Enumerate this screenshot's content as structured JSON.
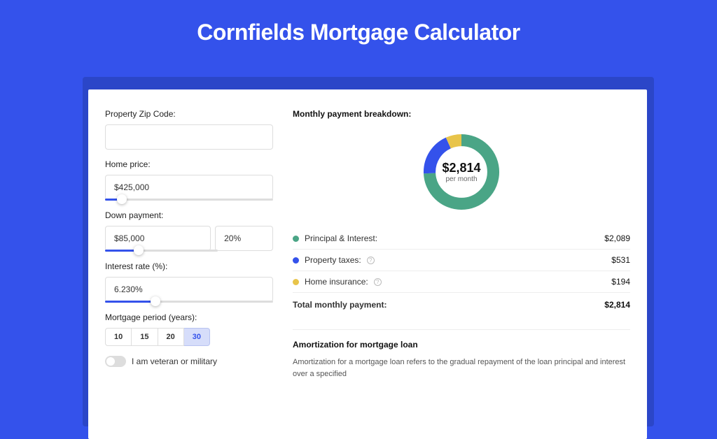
{
  "title": "Cornfields Mortgage Calculator",
  "form": {
    "zip_label": "Property Zip Code:",
    "zip_value": "",
    "home_price_label": "Home price:",
    "home_price_value": "$425,000",
    "down_payment_label": "Down payment:",
    "down_payment_value": "$85,000",
    "down_payment_pct": "20%",
    "interest_label": "Interest rate (%):",
    "interest_value": "6.230%",
    "period_label": "Mortgage period (years):",
    "periods": [
      "10",
      "15",
      "20",
      "30"
    ],
    "period_active": "30",
    "veteran_label": "I am veteran or military"
  },
  "breakdown": {
    "title": "Monthly payment breakdown:",
    "total_amount": "$2,814",
    "per_month": "per month",
    "rows": [
      {
        "label": "Principal & Interest:",
        "value": "$2,089",
        "color": "#4aa586",
        "info": false
      },
      {
        "label": "Property taxes:",
        "value": "$531",
        "color": "#3452eb",
        "info": true
      },
      {
        "label": "Home insurance:",
        "value": "$194",
        "color": "#e8c44a",
        "info": true
      }
    ],
    "total_label": "Total monthly payment:",
    "total_value": "$2,814"
  },
  "amort": {
    "title": "Amortization for mortgage loan",
    "text": "Amortization for a mortgage loan refers to the gradual repayment of the loan principal and interest over a specified"
  },
  "chart_data": {
    "type": "pie",
    "series": [
      {
        "name": "Principal & Interest",
        "value": 2089,
        "color": "#4aa586"
      },
      {
        "name": "Property taxes",
        "value": 531,
        "color": "#3452eb"
      },
      {
        "name": "Home insurance",
        "value": 194,
        "color": "#e8c44a"
      }
    ],
    "total": 2814,
    "center_label": "$2,814",
    "center_sub": "per month"
  }
}
